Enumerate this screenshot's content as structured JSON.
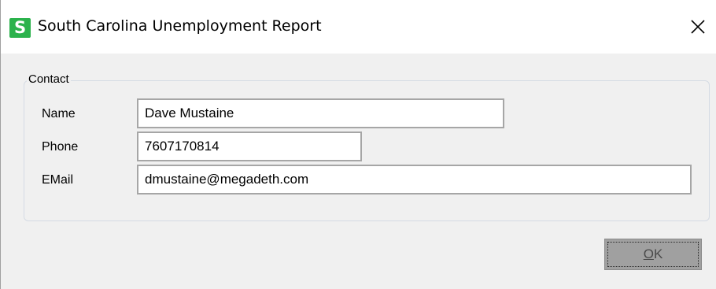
{
  "window": {
    "title": "South Carolina Unemployment Report",
    "app_icon_letter": "S",
    "app_icon_color": "#2bb24c",
    "close_icon": "close-icon"
  },
  "contact": {
    "group_label": "Contact",
    "name_label": "Name",
    "name_value": "Dave Mustaine",
    "phone_label": "Phone",
    "phone_value": "7607170814",
    "email_label": "EMail",
    "email_value": "dmustaine@megadeth.com"
  },
  "buttons": {
    "ok_mnemonic": "O",
    "ok_rest": "K"
  }
}
